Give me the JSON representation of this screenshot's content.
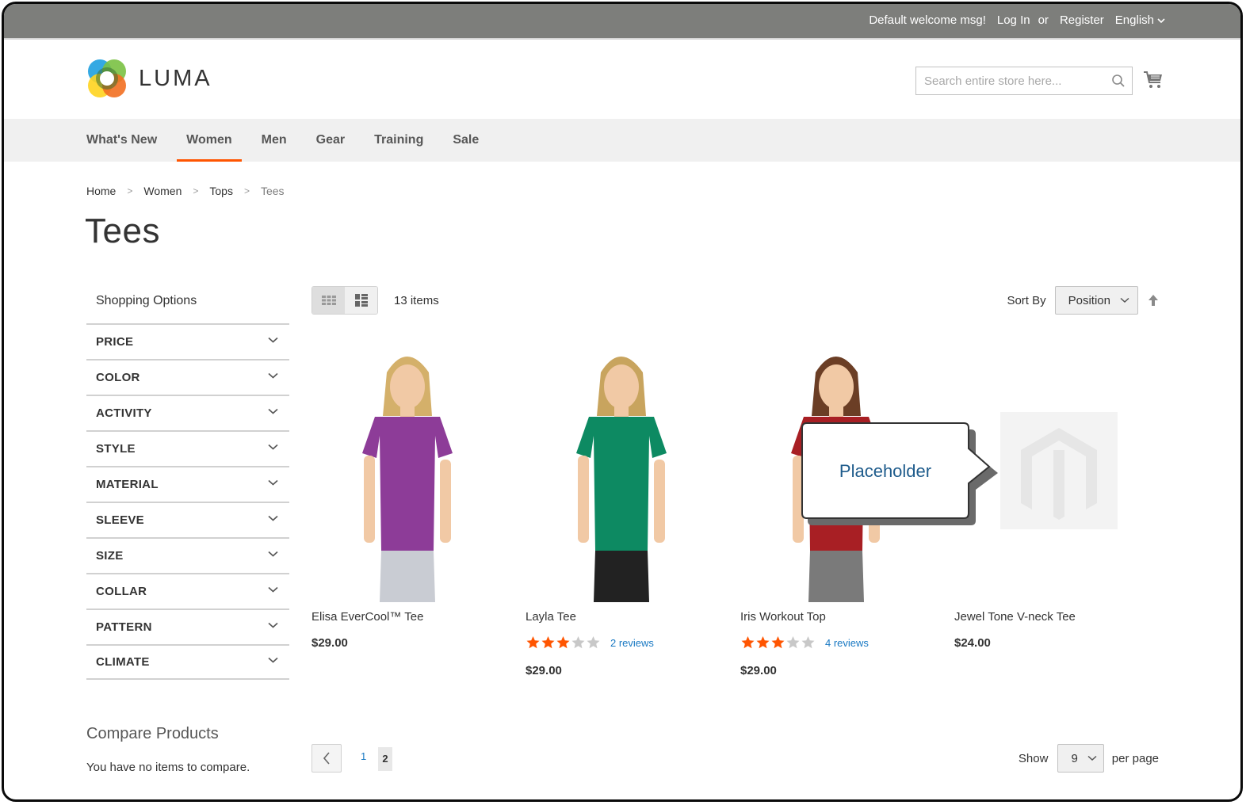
{
  "topbar": {
    "welcome": "Default welcome msg!",
    "login": "Log In",
    "or": "or",
    "register": "Register",
    "language": "English"
  },
  "header": {
    "logo_text": "LUMA",
    "search_placeholder": "Search entire store here...",
    "search_icon": "search-icon",
    "cart_icon": "cart-icon"
  },
  "nav": {
    "items": [
      {
        "label": "What's New",
        "active": false
      },
      {
        "label": "Women",
        "active": true
      },
      {
        "label": "Men",
        "active": false
      },
      {
        "label": "Gear",
        "active": false
      },
      {
        "label": "Training",
        "active": false
      },
      {
        "label": "Sale",
        "active": false
      }
    ],
    "active_color": "#ff5501"
  },
  "breadcrumbs": [
    "Home",
    "Women",
    "Tops",
    "Tees"
  ],
  "page_title": "Tees",
  "sidebar": {
    "title": "Shopping Options",
    "filters": [
      "PRICE",
      "COLOR",
      "ACTIVITY",
      "STYLE",
      "MATERIAL",
      "SLEEVE",
      "SIZE",
      "COLLAR",
      "PATTERN",
      "CLIMATE"
    ],
    "compare": {
      "title": "Compare Products",
      "empty": "You have no items to compare."
    }
  },
  "toolbar": {
    "view_modes": [
      "grid",
      "list"
    ],
    "active_mode": "grid",
    "amount": "13 items",
    "sort_label": "Sort By",
    "sort_value": "Position",
    "sort_direction": "ascending"
  },
  "products": [
    {
      "name": "Elisa EverCool™ Tee",
      "price": "$29.00",
      "rating": null,
      "reviews": null,
      "shirt_color": "#8d3c98",
      "hair": "#d4b06a",
      "bottom": "#c9ccd3"
    },
    {
      "name": "Layla Tee",
      "price": "$29.00",
      "rating": 3,
      "reviews": "2 reviews",
      "shirt_color": "#0d8a62",
      "hair": "#c8a45e",
      "bottom": "#222222"
    },
    {
      "name": "Iris Workout Top",
      "price": "$29.00",
      "rating": 3,
      "reviews": "4 reviews",
      "shirt_color": "#a81f24",
      "hair": "#6b3e25",
      "bottom": "#7a7a7a"
    },
    {
      "name": "Jewel Tone V-neck Tee",
      "price": "$24.00",
      "rating": null,
      "reviews": null,
      "placeholder_image": true
    }
  ],
  "callout": {
    "text": "Placeholder"
  },
  "pager": {
    "pages": [
      "1",
      "2"
    ],
    "current": "2",
    "show_label": "Show",
    "limit": "9",
    "per_page_label": "per page"
  },
  "colors": {
    "topbar_bg": "#7d7e7b",
    "star_filled": "#ff5501",
    "star_empty": "#c8c8c8",
    "link": "#1979c3"
  }
}
